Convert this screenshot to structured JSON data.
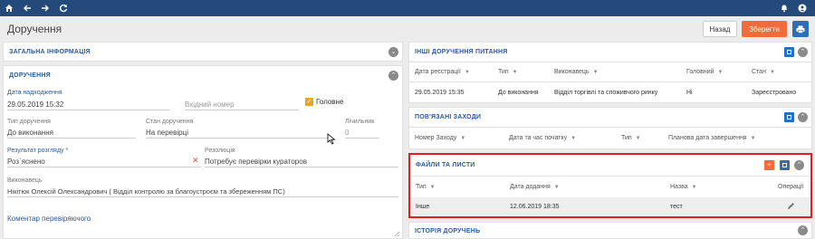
{
  "title": "Доручення",
  "buttons": {
    "back": "Назад",
    "save": "Зберегти"
  },
  "left": {
    "general_title": "ЗАГАЛЬНА ІНФОРМАЦІЯ",
    "assignment_title": "ДОРУЧЕННЯ",
    "date_label": "Дата надходження",
    "date_value": "29.05.2019 15:32",
    "incoming_placeholder": "Вхідний номер",
    "main_label": "Головне",
    "type_label": "Тип доручення",
    "type_value": "До виконання",
    "state_label": "Стан доручення",
    "state_value": "На перевірці",
    "counter_label": "Лічильник",
    "counter_value": "0",
    "result_label": "Результат розгляду *",
    "result_value": "Роз`яснено",
    "resolution_label": "Резолюція",
    "resolution_value": "Потребує перевірки кураторов",
    "executor_label": "Виконавець",
    "executor_value": "Нікітюк Олексій Олександрович ( Відділ контролю за благоустроєм та збереженням ПС)",
    "comment_label": "Коментар перевіряючого"
  },
  "other": {
    "title": "ІНШІ ДОРУЧЕННЯ ПИТАННЯ",
    "headers": [
      "Дата реєстрації",
      "Тип",
      "Виконавець",
      "Головний",
      "Стан"
    ],
    "row": [
      "29.05.2019 15:35",
      "До виконання",
      "Відділ торгівлі та споживчого ринку",
      "Ні",
      "Зареєстровано"
    ]
  },
  "related": {
    "title": "ПОВ'ЯЗАНІ ЗАХОДИ",
    "headers": [
      "Номер Заходу",
      "Дата та час початку",
      "Тип",
      "Планова дата завершення"
    ]
  },
  "files": {
    "title": "ФАЙЛИ ТА ЛИСТИ",
    "headers": [
      "Тип",
      "Дата додання",
      "Назва",
      "Операції"
    ],
    "row": [
      "Інше",
      "12.06.2019 18:35",
      "тест"
    ]
  },
  "history": {
    "title": "ІСТОРІЯ ДОРУЧЕНЬ"
  },
  "colors": {
    "topbar": "#244a7c",
    "accent": "#f26b3a",
    "primary": "#2f6eb5",
    "highlight": "#e02020"
  }
}
